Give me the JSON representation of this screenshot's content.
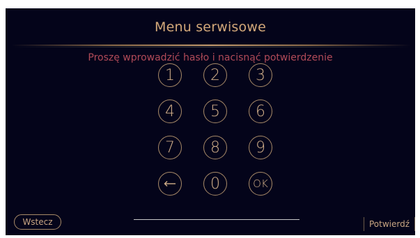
{
  "header": {
    "title": "Menu serwisowe"
  },
  "prompt": "Proszę wprowadzić hasło i nacisnąć potwierdzenie",
  "keypad": {
    "k1": "1",
    "k2": "2",
    "k3": "3",
    "k4": "4",
    "k5": "5",
    "k6": "6",
    "k7": "7",
    "k8": "8",
    "k9": "9",
    "backspace_icon": "arrow-left-icon",
    "k0": "0",
    "ok": "OK"
  },
  "password_value": "",
  "footer": {
    "back_label": "Wstecz",
    "confirm_label": "Potwierdź"
  },
  "colors": {
    "background": "#04041a",
    "accent": "#d3a87a",
    "prompt": "#b14a58",
    "key_border": "#a88a68"
  }
}
